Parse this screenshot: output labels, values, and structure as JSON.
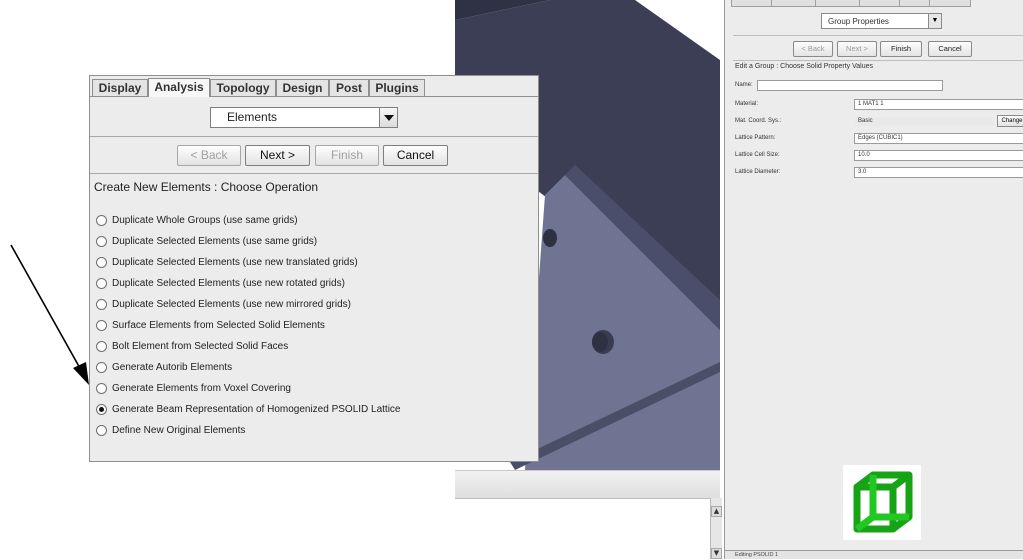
{
  "dialog": {
    "tabs": [
      "Display",
      "Analysis",
      "Topology",
      "Design",
      "Post",
      "Plugins"
    ],
    "active_tab": "Analysis",
    "category_dropdown": {
      "value": "Elements"
    },
    "buttons": {
      "back": "< Back",
      "next": "Next >",
      "finish": "Finish",
      "cancel": "Cancel"
    },
    "heading": "Create New Elements : Choose Operation",
    "options": [
      "Duplicate Whole Groups (use same grids)",
      "Duplicate Selected Elements (use same grids)",
      "Duplicate Selected Elements (use new translated grids)",
      "Duplicate Selected Elements (use new rotated grids)",
      "Duplicate Selected Elements (use new mirrored grids)",
      "Surface Elements from Selected Solid Elements",
      "Bolt Element from Selected Solid Faces",
      "Generate Autorib Elements",
      "Generate Elements from Voxel Covering",
      "Generate Beam Representation of Homogenized PSOLID Lattice",
      "Define New Original Elements"
    ],
    "selected_option_index": 9
  },
  "right_panel": {
    "dropdown": {
      "value": "Group Properties"
    },
    "buttons": {
      "back": "< Back",
      "next": "Next >",
      "finish": "Finish",
      "cancel": "Cancel"
    },
    "heading": "Edit a Group : Choose Solid Property Values",
    "fields": {
      "name_label": "Name:",
      "name_value": "",
      "material_label": "Material:",
      "material_value": "1 MAT1 1",
      "coord_label": "Mat. Coord. Sys.:",
      "coord_value": "Basic",
      "change_label": "Change",
      "pattern_label": "Lattice Pattern:",
      "pattern_value": "Edges (CUBIC1)",
      "cell_size_label": "Lattice Cell Size:",
      "cell_size_value": "10.0",
      "diameter_label": "Lattice Diameter:",
      "diameter_value": "3.0"
    },
    "status": "Editing PSOLID 1"
  },
  "colors": {
    "panel_bg": "#ececec",
    "model_top": "#3a3d52",
    "model_face": "#6e7390",
    "lattice_green": "#1bb51b"
  },
  "icons": {
    "lattice": "cube-lattice-icon",
    "arrow": "pointer-arrow"
  }
}
